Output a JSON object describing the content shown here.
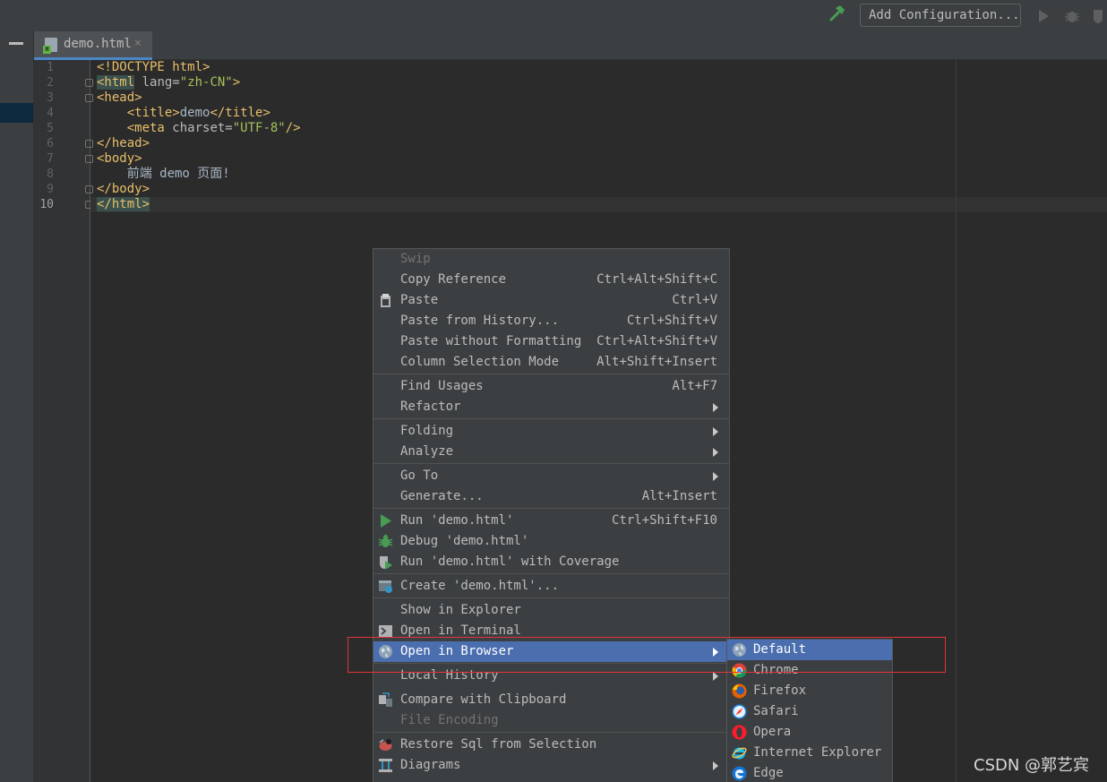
{
  "toolbar": {
    "add_configuration_label": "Add Configuration..."
  },
  "tab": {
    "label": "demo.html",
    "close_glyph": "×"
  },
  "gutter": {
    "line_numbers": [
      "1",
      "2",
      "3",
      "4",
      "5",
      "6",
      "7",
      "8",
      "9",
      "10"
    ]
  },
  "code": {
    "lines": [
      [
        {
          "t": "<!DOCTYPE html>",
          "c": "tag"
        }
      ],
      [
        {
          "t": "<html",
          "c": "tag hl"
        },
        {
          "t": " lang=",
          "c": "attr"
        },
        {
          "t": "\"zh-CN\"",
          "c": "val"
        },
        {
          "t": ">",
          "c": "tag"
        }
      ],
      [
        {
          "t": "<head>",
          "c": "tag"
        }
      ],
      [
        {
          "t": "    ",
          "c": "txt"
        },
        {
          "t": "<title>",
          "c": "tag"
        },
        {
          "t": "demo",
          "c": "txt"
        },
        {
          "t": "</title>",
          "c": "tag"
        }
      ],
      [
        {
          "t": "    ",
          "c": "txt"
        },
        {
          "t": "<meta",
          "c": "tag"
        },
        {
          "t": " charset=",
          "c": "attr"
        },
        {
          "t": "\"UTF-8\"",
          "c": "val"
        },
        {
          "t": "/>",
          "c": "tag"
        }
      ],
      [
        {
          "t": "</head>",
          "c": "tag"
        }
      ],
      [
        {
          "t": "<body>",
          "c": "tag"
        }
      ],
      [
        {
          "t": "    前端 demo 页面!",
          "c": "txt"
        }
      ],
      [
        {
          "t": "</body>",
          "c": "tag"
        }
      ],
      [
        {
          "t": "</html>",
          "c": "tag hl"
        }
      ]
    ]
  },
  "menu": {
    "items": [
      {
        "label": "Swip",
        "shortcut": "",
        "disabled": true
      },
      {
        "label": "Copy Reference",
        "shortcut": "Ctrl+Alt+Shift+C"
      },
      {
        "label": "Paste",
        "shortcut": "Ctrl+V",
        "icon": "clipboard-icon"
      },
      {
        "label": "Paste from History...",
        "shortcut": "Ctrl+Shift+V"
      },
      {
        "label": "Paste without Formatting",
        "shortcut": "Ctrl+Alt+Shift+V"
      },
      {
        "label": "Column Selection Mode",
        "shortcut": "Alt+Shift+Insert"
      },
      {
        "label": "Find Usages",
        "shortcut": "Alt+F7"
      },
      {
        "label": "Refactor",
        "shortcut": "",
        "submenu": true
      },
      {
        "label": "Folding",
        "shortcut": "",
        "submenu": true
      },
      {
        "label": "Analyze",
        "shortcut": "",
        "submenu": true
      },
      {
        "label": "Go To",
        "shortcut": "",
        "submenu": true
      },
      {
        "label": "Generate...",
        "shortcut": "Alt+Insert"
      },
      {
        "label": "Run 'demo.html'",
        "shortcut": "Ctrl+Shift+F10",
        "icon": "run-icon"
      },
      {
        "label": "Debug 'demo.html'",
        "shortcut": "",
        "icon": "debug-icon"
      },
      {
        "label": "Run 'demo.html' with Coverage",
        "shortcut": "",
        "icon": "coverage-icon"
      },
      {
        "label": "Create 'demo.html'...",
        "shortcut": "",
        "icon": "create-config-icon"
      },
      {
        "label": "Show in Explorer",
        "shortcut": ""
      },
      {
        "label": "Open in Terminal",
        "shortcut": "",
        "icon": "terminal-icon"
      },
      {
        "label": "Open in Browser",
        "shortcut": "",
        "submenu": true,
        "selected": true,
        "icon": "globe-icon"
      },
      {
        "label": "Local History",
        "shortcut": "",
        "submenu": true
      },
      {
        "label": "Compare with Clipboard",
        "shortcut": "",
        "icon": "compare-icon"
      },
      {
        "label": "File Encoding",
        "shortcut": "",
        "disabled": true
      },
      {
        "label": "Restore Sql from Selection",
        "shortcut": "",
        "icon": "restore-sql-icon"
      },
      {
        "label": "Diagrams",
        "shortcut": "",
        "submenu": true,
        "icon": "diagrams-icon"
      }
    ]
  },
  "submenu": {
    "items": [
      {
        "label": "Default",
        "icon": "globe-icon",
        "selected": true
      },
      {
        "label": "Chrome",
        "icon": "chrome-icon"
      },
      {
        "label": "Firefox",
        "icon": "firefox-icon"
      },
      {
        "label": "Safari",
        "icon": "safari-icon"
      },
      {
        "label": "Opera",
        "icon": "opera-icon"
      },
      {
        "label": "Internet Explorer",
        "icon": "internet-explorer-icon"
      },
      {
        "label": "Edge",
        "icon": "edge-icon"
      }
    ]
  },
  "watermark": "CSDN @郭艺宾",
  "colors": {
    "accent": "#4b6eaf",
    "annotation": "#e0353a",
    "run_green": "#499c54"
  }
}
